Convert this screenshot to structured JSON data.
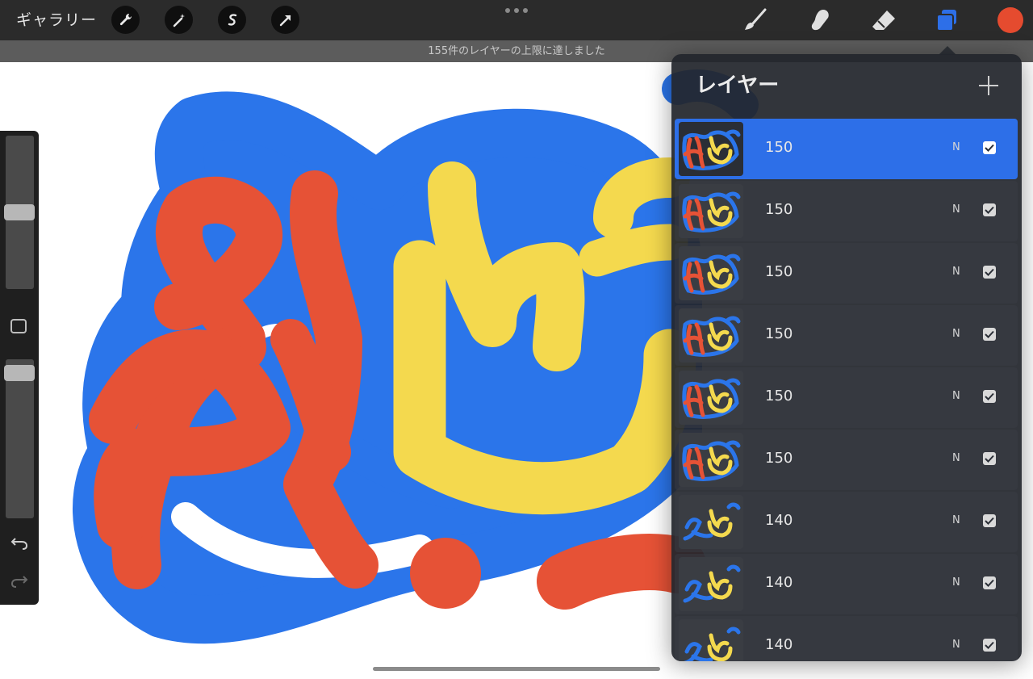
{
  "topbar": {
    "gallery_label": "ギャラリー",
    "left_tools": [
      "wrench-icon",
      "magic-wand-icon",
      "selection-icon",
      "transform-arrow-icon"
    ],
    "right_tools": [
      "brush-icon",
      "smudge-icon",
      "eraser-icon",
      "layers-icon"
    ],
    "current_color": "#e54b2f"
  },
  "notice": {
    "text": "155件のレイヤーの上限に達しました"
  },
  "canvas": {
    "colors": {
      "blue": "#2b75ea",
      "red": "#e65236",
      "yellow": "#f4d94e"
    }
  },
  "sidebar": {
    "controls": [
      "brush-size-slider",
      "modify-button",
      "opacity-slider",
      "undo-icon",
      "redo-icon"
    ]
  },
  "layers_panel": {
    "title": "レイヤー",
    "layers": [
      {
        "name": "150",
        "blend": "N",
        "visible": true,
        "selected": true
      },
      {
        "name": "150",
        "blend": "N",
        "visible": true,
        "selected": false
      },
      {
        "name": "150",
        "blend": "N",
        "visible": true,
        "selected": false
      },
      {
        "name": "150",
        "blend": "N",
        "visible": true,
        "selected": false
      },
      {
        "name": "150",
        "blend": "N",
        "visible": true,
        "selected": false
      },
      {
        "name": "150",
        "blend": "N",
        "visible": true,
        "selected": false
      },
      {
        "name": "140",
        "blend": "N",
        "visible": true,
        "selected": false
      },
      {
        "name": "140",
        "blend": "N",
        "visible": true,
        "selected": false
      },
      {
        "name": "140",
        "blend": "N",
        "visible": true,
        "selected": false
      }
    ]
  }
}
